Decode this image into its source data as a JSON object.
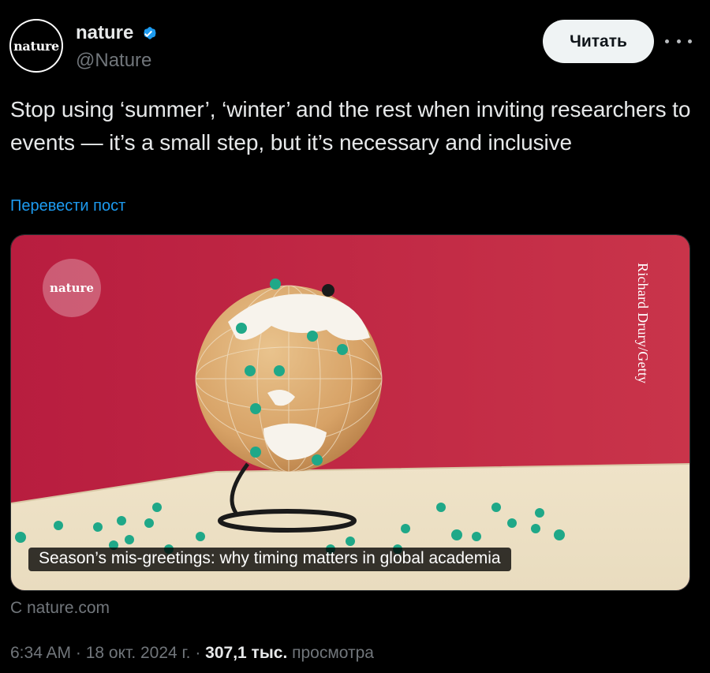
{
  "author": {
    "avatar_text": "nature",
    "display_name": "nature",
    "handle": "@Nature",
    "verified_icon": "verified-badge-icon",
    "verified_color": "#1d9bf0"
  },
  "follow_button": {
    "label": "Читать"
  },
  "more_menu": {
    "icon": "more-horizontal-icon"
  },
  "post": {
    "text": "Stop using ‘summer’, ‘winter’ and the rest when inviting researchers to events — it’s a small step, but it’s necessary and inclusive",
    "translate_label": "Перевести пост"
  },
  "card": {
    "logo_text": "nature",
    "photo_credit": "Richard Drury/Getty",
    "caption": "Season’s mis-greetings: why timing matters in global academia",
    "source": "С nature.com"
  },
  "meta": {
    "time": "6:34 AM",
    "separator_1": " · ",
    "date": "18 окт. 2024 г.",
    "separator_2": " · ",
    "views_count": "307,1 тыс.",
    "views_label": " просмотра"
  },
  "colors": {
    "background": "#000000",
    "text_primary": "#e7e9ea",
    "text_secondary": "#71767b",
    "link": "#1d9bf0",
    "button_bg": "#eff3f4"
  }
}
